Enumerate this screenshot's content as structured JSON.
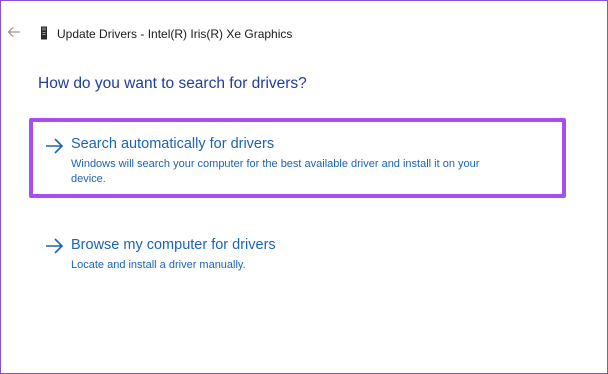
{
  "window": {
    "title": "Update Drivers - Intel(R) Iris(R) Xe Graphics",
    "back_icon": "back-arrow-icon",
    "device_icon": "display-adapter-icon"
  },
  "main": {
    "heading": "How do you want to search for drivers?",
    "options": [
      {
        "title": "Search automatically for drivers",
        "description": "Windows will search your computer for the best available driver and install it on your device.",
        "highlighted": true,
        "icon": "arrow-right-icon"
      },
      {
        "title": "Browse my computer for drivers",
        "description": "Locate and install a driver manually.",
        "highlighted": false,
        "icon": "arrow-right-icon"
      }
    ]
  },
  "colors": {
    "heading": "#1f3d99",
    "link": "#1b63b7",
    "highlight_border": "#a64ff0",
    "window_border": "#8a4fd1"
  }
}
